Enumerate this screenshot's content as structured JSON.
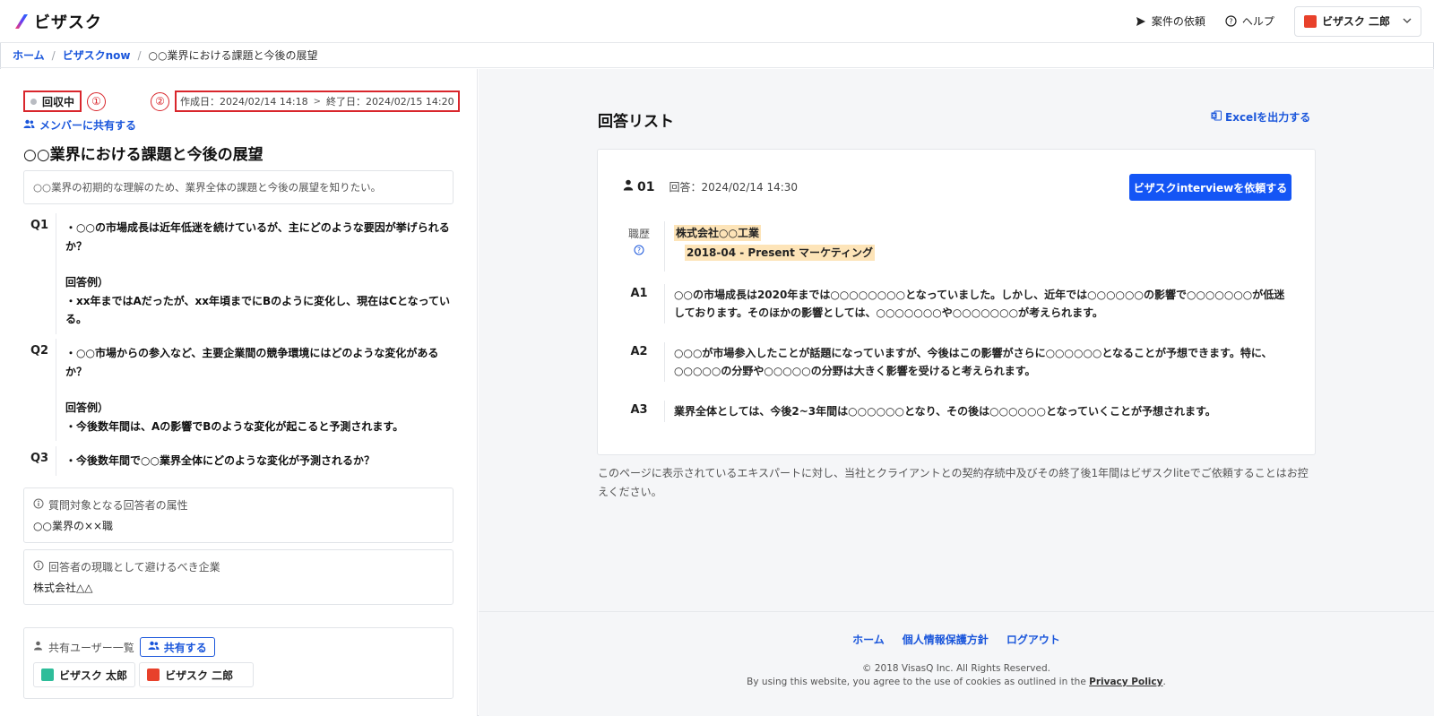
{
  "header": {
    "logo_text": "ビザスク",
    "request_label": "案件の依頼",
    "help_label": "ヘルプ",
    "user_name": "ビザスク 二郎"
  },
  "breadcrumb": {
    "home": "ホーム",
    "section": "ビザスクnow",
    "current": "○○業界における課題と今後の展望"
  },
  "left": {
    "status": "回収中",
    "marker1": "①",
    "marker2": "②",
    "created": "作成日：2024/02/14 14:18",
    "arrow": ">",
    "ended": "終了日：2024/02/15 14:20",
    "share_member": "メンバーに共有する",
    "title": "○○業界における課題と今後の展望",
    "purpose": "○○業界の初期的な理解のため、業界全体の課題と今後の展望を知りたい。",
    "questions": [
      {
        "label": "Q1",
        "line1": "・○○の市場成長は近年低迷を続けているが、主にどのような要因が挙げられるか？",
        "example_label": "回答例）",
        "example": "・xx年まではAだったが、xx年頃までにBのように変化し、現在はCとなっている。"
      },
      {
        "label": "Q2",
        "line1": "・○○市場からの参入など、主要企業間の競争環境にはどのような変化があるか？",
        "example_label": "回答例）",
        "example": "・今後数年間は、Aの影響でBのような変化が起こると予測されます。"
      },
      {
        "label": "Q3",
        "line1": "・今後数年間で○○業界全体にどのような変化が予測されるか？"
      }
    ],
    "target_attr_title": "質問対象となる回答者の属性",
    "target_attr_value": "○○業界の××職",
    "avoid_title": "回答者の現職として避けるべき企業",
    "avoid_value": "株式会社△△",
    "shared_users_title": "共有ユーザー一覧",
    "share_button": "共有する",
    "users": [
      "ビザスク 太郎",
      "ビザスク 二郎"
    ]
  },
  "right": {
    "list_title": "回答リスト",
    "excel_label": "Excelを出力する",
    "response": {
      "id": "01",
      "date": "回答：2024/02/14 14:30",
      "interview_button": "ビザスクinterviewを依頼する",
      "career_label": "職歴",
      "company": "株式会社○○工業",
      "role": "2018-04 - Present マーケティング",
      "answers": [
        {
          "label": "A1",
          "text": "○○の市場成長は2020年までは○○○○○○○○となっていました。しかし、近年では○○○○○○の影響で○○○○○○○が低迷しております。そのほかの影響としては、○○○○○○○や○○○○○○○が考えられます。"
        },
        {
          "label": "A2",
          "text": "○○○が市場参入したことが話題になっていますが、今後はこの影響がさらに○○○○○○となることが予想できます。特に、○○○○○の分野や○○○○○の分野は大きく影響を受けると考えられます。"
        },
        {
          "label": "A3",
          "text": "業界全体としては、今後2~3年間は○○○○○○となり、その後は○○○○○○となっていくことが予想されます。"
        }
      ]
    },
    "notice": "このページに表示されているエキスパートに対し、当社とクライアントとの契約存続中及びその終了後1年間はビザスクliteでご依頼することはお控えください。"
  },
  "footer": {
    "links": [
      "ホーム",
      "個人情報保護方針",
      "ログアウト"
    ],
    "copyright": "© 2018 VisasQ Inc. All Rights Reserved.",
    "cookie_prefix": "By using this website, you agree to the use of cookies as outlined in the",
    "privacy_policy": "Privacy Policy",
    "period": "."
  },
  "colors": {
    "accent": "#1455f5",
    "link": "#1a56db",
    "annotation_red": "#d9262c",
    "highlight": "#fde4b8"
  }
}
